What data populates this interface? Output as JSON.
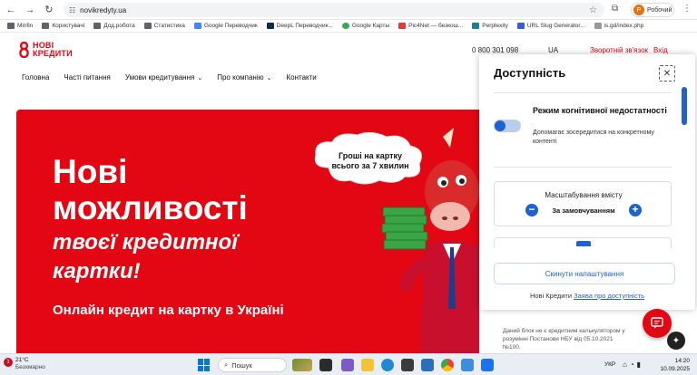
{
  "browser": {
    "url": "novikredyty.ua",
    "profile_label": "Робочий",
    "profile_initial": "P"
  },
  "bookmarks": [
    {
      "label": "Minfin",
      "icon": "folder-icon"
    },
    {
      "label": "Користувачі",
      "icon": "folder-icon"
    },
    {
      "label": "Дод.робота",
      "icon": "folder-icon"
    },
    {
      "label": "Статистика",
      "icon": "folder-icon"
    },
    {
      "label": "Google Переводчик",
      "icon": "translate-icon"
    },
    {
      "label": "DeepL Переводчик...",
      "icon": "deepl-icon"
    },
    {
      "label": "Google Карты",
      "icon": "maps-icon"
    },
    {
      "label": "Pic4Net — безкош...",
      "icon": "pic-icon"
    },
    {
      "label": "Perplexity",
      "icon": "perplexity-icon"
    },
    {
      "label": "URL Slug Generator...",
      "icon": "slug-icon"
    },
    {
      "label": "is.gd/index.php",
      "icon": "isgd-icon"
    }
  ],
  "site": {
    "logo_line1": "НОВІ",
    "logo_line2": "КРЕДИТИ",
    "phone": "0 800 301 098",
    "lang": "UA",
    "callback": "Зворотній зв'язок",
    "login": "Вхід",
    "nav": [
      {
        "label": "Головна",
        "has_dropdown": false
      },
      {
        "label": "Часті питання",
        "has_dropdown": false
      },
      {
        "label": "Умови кредитування",
        "has_dropdown": true
      },
      {
        "label": "Про компанію",
        "has_dropdown": true
      },
      {
        "label": "Контакти",
        "has_dropdown": false
      }
    ],
    "hero": {
      "title_line1": "Нові",
      "title_line2": "можливості",
      "subtitle_line1": "твоєї кредитної",
      "subtitle_line2": "картки!",
      "tagline": "Онлайн кредит на картку в Україні",
      "bubble_text": "Гроші на картку всього за 7 хвилин",
      "color": "#e30613"
    },
    "calc_note": "Даний блок не є кредитним калькулятором у розумінні Постанови НБУ від 05.10.2021 №100."
  },
  "accessibility": {
    "title": "Доступність",
    "cognitive_title": "Режим когнітивної недостатності",
    "cognitive_desc": "Допомагає зосередитися на конкретному контенті",
    "cognitive_enabled": false,
    "scale_label": "Масштабування вмісту",
    "scale_value": "За замовчуванням",
    "reset_label": "Скинути налаштування",
    "footer_prefix": "Нові Кредити",
    "footer_link": "Заява про доступність",
    "accent": "#1e62d0"
  },
  "taskbar": {
    "weather_badge": "1",
    "temperature": "21°C",
    "condition": "Безхмарно",
    "search_placeholder": "Пошук",
    "lang": "УКР",
    "time": "14:20",
    "date": "10.09.2025"
  }
}
